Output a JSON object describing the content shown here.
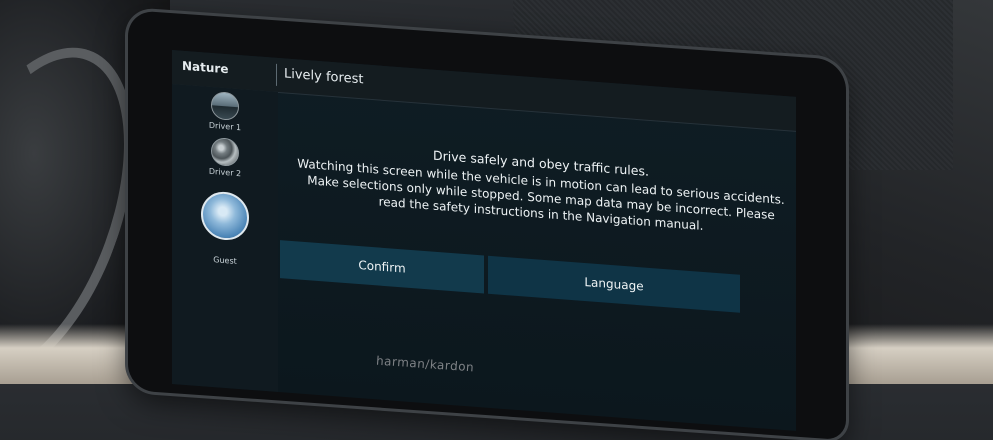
{
  "topbar": {
    "theme_label": "Nature",
    "scene_label": "Lively forest"
  },
  "profiles": [
    {
      "label": "Driver 1",
      "icon": "landscape-avatar"
    },
    {
      "label": "Driver 2",
      "icon": "abstract-avatar"
    },
    {
      "label": "Guest",
      "icon": "sky-avatar"
    }
  ],
  "notice": {
    "headline": "Drive safely and obey traffic rules.",
    "body": "Watching this screen while the vehicle is in motion can lead to serious accidents. Make selections only while stopped. Some map data may be incorrect. Please read the safety instructions in the Navigation manual."
  },
  "buttons": {
    "confirm_label": "Confirm",
    "language_label": "Language"
  },
  "bezel": {
    "brand": "harman/kardon"
  },
  "colors": {
    "screen_bg": "#0f1d24",
    "button_bg": "#123a4c",
    "text": "#e6ecef"
  }
}
